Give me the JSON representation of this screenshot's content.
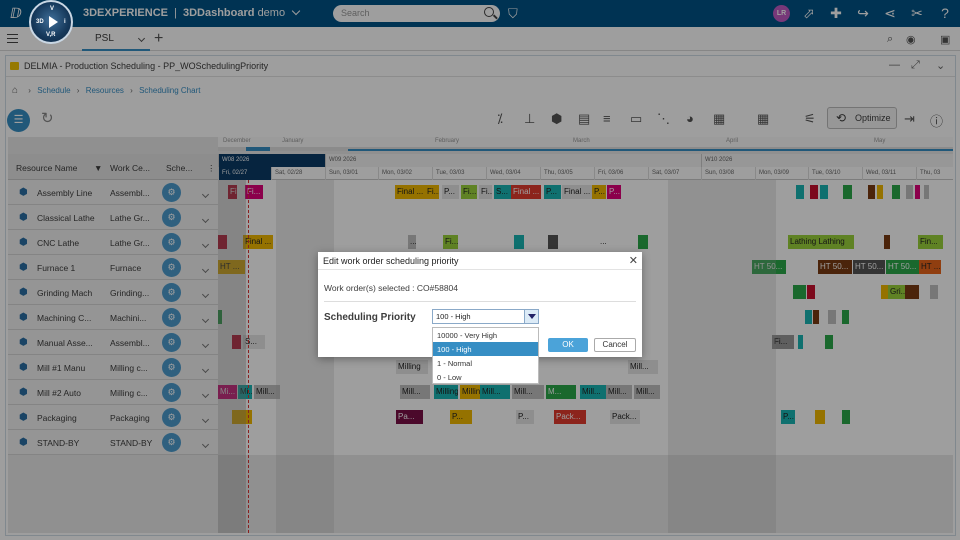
{
  "topbar": {
    "brand_prefix": "3DEXPERIENCE",
    "brand_app": "3DDashboard",
    "tenant": "demo",
    "search_placeholder": "Search",
    "avatar_initials": "LR",
    "compass_labels": [
      "3D",
      "V",
      "V,R",
      "i"
    ]
  },
  "tabs": {
    "active": "PSL",
    "add": "+"
  },
  "app": {
    "title": "DELMIA - Production Scheduling - PP_WOSchedulingPriority",
    "breadcrumb": [
      "Schedule",
      "Resources",
      "Scheduling Chart"
    ],
    "optimize_label": "Optimize"
  },
  "timeline": {
    "months": [
      "December",
      "January",
      "February",
      "March",
      "April",
      "May"
    ],
    "weeks": [
      "W08 2026",
      "W09 2026",
      "W10 2026"
    ],
    "days": [
      "Fri, 02/27",
      "Sat, 02/28",
      "Sun, 03/01",
      "Mon, 03/02",
      "Tue, 03/03",
      "Wed, 03/04",
      "Thu, 03/05",
      "Fri, 03/06",
      "Sat, 03/07",
      "Sun, 03/08",
      "Mon, 03/09",
      "Tue, 03/10",
      "Wed, 03/11",
      "Thu, 03"
    ]
  },
  "columns": {
    "resource": "Resource Name",
    "workcenter": "Work Ce...",
    "schedule": "Sche..."
  },
  "rows": [
    {
      "name": "Assembly Line",
      "wc": "Assembl...",
      "bars": [
        {
          "t": "Fi...",
          "c": "#c8102e"
        },
        {
          "t": "Fi...",
          "c": "#e0007a"
        },
        {
          "t": "Final ...",
          "c": "#f0b800"
        },
        {
          "t": "Fi...",
          "c": "#f0b800"
        },
        {
          "t": "P...",
          "c": "#e6e6e6"
        },
        {
          "t": "Fi...",
          "c": "#9ad23b"
        },
        {
          "t": "Fi...",
          "c": "#e6e6e6"
        },
        {
          "t": "S...",
          "c": "#19b5b3"
        },
        {
          "t": "Final ...",
          "c": "#e33b2e"
        },
        {
          "t": "P...",
          "c": "#19b5b3"
        },
        {
          "t": "Final ...",
          "c": "#e6e6e6"
        },
        {
          "t": "P...",
          "c": "#f0b800"
        },
        {
          "t": "P...",
          "c": "#e0007a"
        },
        {
          "t": "",
          "c": "#19b5b3"
        },
        {
          "t": "",
          "c": "#c8102e"
        },
        {
          "t": "",
          "c": "#19b5b3"
        },
        {
          "t": "",
          "c": "#2aa84a"
        },
        {
          "t": "",
          "c": "#7a3b12"
        },
        {
          "t": "",
          "c": "#f0b800"
        },
        {
          "t": "",
          "c": "#2aa84a"
        },
        {
          "t": "",
          "c": "#c0c0c0"
        },
        {
          "t": "",
          "c": "#e0007a"
        },
        {
          "t": "",
          "c": "#c0c0c0"
        }
      ]
    },
    {
      "name": "Classical Lathe",
      "wc": "Lathe Gr...",
      "bars": []
    },
    {
      "name": "CNC Lathe",
      "wc": "Lathe Gr...",
      "bars": [
        {
          "t": "",
          "c": "#c8102e"
        },
        {
          "t": "Final ...",
          "c": "#f0b800"
        },
        {
          "t": "...",
          "c": "#c0c0c0"
        },
        {
          "t": "Fi...",
          "c": "#9ad23b"
        },
        {
          "t": "",
          "c": "#19b5b3"
        },
        {
          "t": "",
          "c": "#555"
        },
        {
          "t": "...",
          "c": "#fff"
        },
        {
          "t": "",
          "c": "#2aa84a"
        },
        {
          "t": "Lathing Lathing",
          "c": "#9ad23b"
        },
        {
          "t": "",
          "c": "#7a3b12"
        },
        {
          "t": "Fin...",
          "c": "#9ad23b"
        }
      ]
    },
    {
      "name": "Furnace 1",
      "wc": "Furnace",
      "bars": [
        {
          "t": "HT ...",
          "c": "#f0b800"
        },
        {
          "t": "HT 50...",
          "c": "#2aa84a"
        },
        {
          "t": "HT 50...",
          "c": "#7a3b12"
        },
        {
          "t": "HT 50...",
          "c": "#555"
        },
        {
          "t": "HT 50...",
          "c": "#2aa84a"
        },
        {
          "t": "HT ...",
          "c": "#e8651a"
        }
      ]
    },
    {
      "name": "Grinding Mach",
      "wc": "Grinding...",
      "bars": [
        {
          "t": "",
          "c": "#2aa84a"
        },
        {
          "t": "",
          "c": "#c8102e"
        },
        {
          "t": "",
          "c": "#f0b800"
        },
        {
          "t": "Gri...",
          "c": "#9ad23b"
        },
        {
          "t": "",
          "c": "#7a3b12"
        },
        {
          "t": "",
          "c": "#c0c0c0"
        }
      ]
    },
    {
      "name": "Machining C...",
      "wc": "Machini...",
      "bars": [
        {
          "t": "",
          "c": "#2aa84a"
        },
        {
          "t": "",
          "c": "#19b5b3"
        },
        {
          "t": "",
          "c": "#7a3b12"
        },
        {
          "t": "",
          "c": "#c0c0c0"
        },
        {
          "t": "",
          "c": "#2aa84a"
        }
      ]
    },
    {
      "name": "Manual Asse...",
      "wc": "Assembl...",
      "bars": [
        {
          "t": "",
          "c": "#c8102e"
        },
        {
          "t": "S...",
          "c": "#e6e6e6"
        },
        {
          "t": "Fi...",
          "c": "#999"
        },
        {
          "t": "",
          "c": "#19b5b3"
        },
        {
          "t": "",
          "c": "#2aa84a"
        }
      ]
    },
    {
      "name": "Mill #1 Manu",
      "wc": "Milling c...",
      "bars": [
        {
          "t": "Milling",
          "c": "#e6e6e6"
        },
        {
          "t": "Mill...",
          "c": "#e6e6e6"
        }
      ]
    },
    {
      "name": "Mill #2 Auto",
      "wc": "Milling c...",
      "bars": [
        {
          "t": "Mi...",
          "c": "#e0007a"
        },
        {
          "t": "Mi...",
          "c": "#19b5b3"
        },
        {
          "t": "Mill...",
          "c": "#c0c0c0"
        },
        {
          "t": "Mill...",
          "c": "#c0c0c0"
        },
        {
          "t": "Milling",
          "c": "#19b5b3"
        },
        {
          "t": "Milling",
          "c": "#f0b800"
        },
        {
          "t": "Mill...",
          "c": "#19b5b3"
        },
        {
          "t": "Mill...",
          "c": "#c0c0c0"
        },
        {
          "t": "M...",
          "c": "#2aa84a"
        },
        {
          "t": "Mill...",
          "c": "#19b5b3"
        },
        {
          "t": "Mill...",
          "c": "#c0c0c0"
        },
        {
          "t": "Mill...",
          "c": "#c0c0c0"
        }
      ]
    },
    {
      "name": "Packaging",
      "wc": "Packaging",
      "bars": [
        {
          "t": "",
          "c": "#f0b800"
        },
        {
          "t": "Pa...",
          "c": "#7a1046"
        },
        {
          "t": "P...",
          "c": "#f0b800"
        },
        {
          "t": "P...",
          "c": "#e6e6e6"
        },
        {
          "t": "Pack...",
          "c": "#e33b2e"
        },
        {
          "t": "Pack...",
          "c": "#e6e6e6"
        },
        {
          "t": "P...",
          "c": "#19b5b3"
        },
        {
          "t": "",
          "c": "#f0b800"
        },
        {
          "t": "",
          "c": "#2aa84a"
        }
      ]
    },
    {
      "name": "STAND-BY",
      "wc": "STAND-BY",
      "bars": []
    }
  ],
  "dialog": {
    "title": "Edit work order scheduling priority",
    "selected_text": "Work order(s) selected : CO#58804",
    "priority_label": "Scheduling Priority",
    "priority_value": "100 - High",
    "options": [
      "10000 - Very High",
      "100 - High",
      "1 - Normal",
      "0 - Low"
    ],
    "ok": "OK",
    "cancel": "Cancel"
  },
  "colors": {
    "topbar": "#005386",
    "accent": "#368ec4",
    "nowline": "#dd3333"
  }
}
